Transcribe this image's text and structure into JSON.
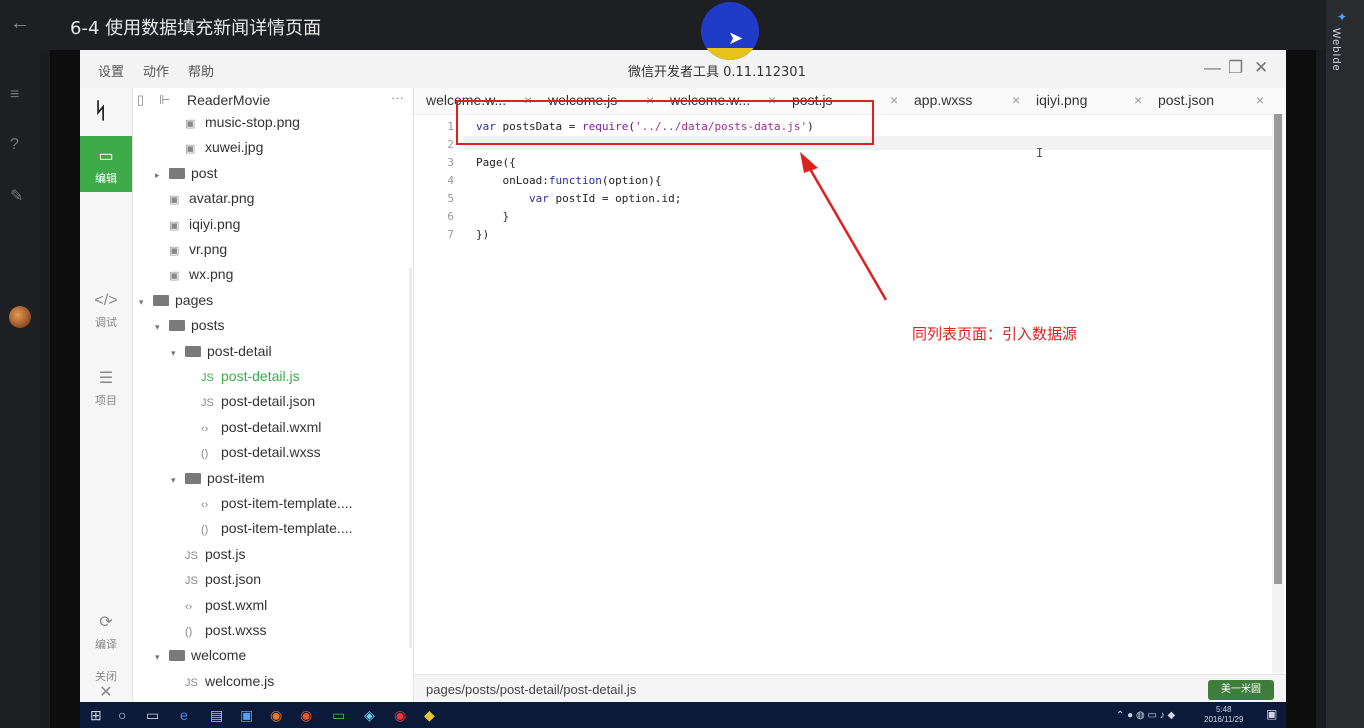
{
  "video": {
    "title": "6-4 使用数据填充新闻详情页面",
    "right_badge": "WebIde"
  },
  "ide": {
    "menus": [
      "设置",
      "动作",
      "帮助"
    ],
    "window_title": "微信开发者工具 0.11.112301",
    "nav": [
      {
        "label": "编辑",
        "icon": "code-box-icon"
      },
      {
        "label": "调试",
        "icon": "debug-icon"
      },
      {
        "label": "项目",
        "icon": "list-icon"
      },
      {
        "label": "编译",
        "icon": "compile-icon"
      },
      {
        "label": "关闭",
        "icon": "close-icon"
      }
    ],
    "project_name": "ReaderMovie",
    "tree": [
      {
        "label": "music-stop.png",
        "type": "img",
        "depth": 3
      },
      {
        "label": "xuwei.jpg",
        "type": "img",
        "depth": 3
      },
      {
        "label": "post",
        "type": "folder",
        "depth": 2,
        "state": "collapsed"
      },
      {
        "label": "avatar.png",
        "type": "img",
        "depth": 2
      },
      {
        "label": "iqiyi.png",
        "type": "img",
        "depth": 2
      },
      {
        "label": "vr.png",
        "type": "img",
        "depth": 2
      },
      {
        "label": "wx.png",
        "type": "img",
        "depth": 2
      },
      {
        "label": "pages",
        "type": "folder",
        "depth": 1,
        "state": "open"
      },
      {
        "label": "posts",
        "type": "folder",
        "depth": 2,
        "state": "open"
      },
      {
        "label": "post-detail",
        "type": "folder",
        "depth": 3,
        "state": "open"
      },
      {
        "label": "post-detail.js",
        "type": "js",
        "depth": 4,
        "selected": true
      },
      {
        "label": "post-detail.json",
        "type": "js",
        "depth": 4
      },
      {
        "label": "post-detail.wxml",
        "type": "wxml",
        "depth": 4
      },
      {
        "label": "post-detail.wxss",
        "type": "wxss",
        "depth": 4
      },
      {
        "label": "post-item",
        "type": "folder",
        "depth": 3,
        "state": "open"
      },
      {
        "label": "post-item-template....",
        "type": "wxml",
        "depth": 4
      },
      {
        "label": "post-item-template....",
        "type": "wxss",
        "depth": 4
      },
      {
        "label": "post.js",
        "type": "js",
        "depth": 3
      },
      {
        "label": "post.json",
        "type": "js",
        "depth": 3
      },
      {
        "label": "post.wxml",
        "type": "wxml",
        "depth": 3
      },
      {
        "label": "post.wxss",
        "type": "wxss",
        "depth": 3
      },
      {
        "label": "welcome",
        "type": "folder",
        "depth": 2,
        "state": "open"
      },
      {
        "label": "welcome.js",
        "type": "js",
        "depth": 3
      }
    ],
    "tabs": [
      "welcome.w...",
      "welcome.js",
      "welcome.w...",
      "post.js",
      "app.wxss",
      "iqiyi.png",
      "post.json"
    ],
    "tab_close": "×",
    "code_lines": [
      {
        "n": "1",
        "text": "var postsData = require('../../data/posts-data.js')"
      },
      {
        "n": "2",
        "text": ""
      },
      {
        "n": "3",
        "text": "Page({"
      },
      {
        "n": "4",
        "text": "    onLoad:function(option){"
      },
      {
        "n": "5",
        "text": "        var postId = option.id;"
      },
      {
        "n": "6",
        "text": "    }"
      },
      {
        "n": "7",
        "text": "})"
      }
    ],
    "status_path": "pages/posts/post-detail/post-detail.js",
    "watermark": "美一米圆"
  },
  "annotation": {
    "text": "同列表页面：引入数据源",
    "color": "#e0201e"
  },
  "taskbar": {
    "clock_time": "5:48",
    "clock_date": "2016/11/29"
  },
  "colors": {
    "accent_green": "#3dab4a",
    "annotation_red": "#e0201e",
    "taskbar": "#0c1a3a"
  }
}
